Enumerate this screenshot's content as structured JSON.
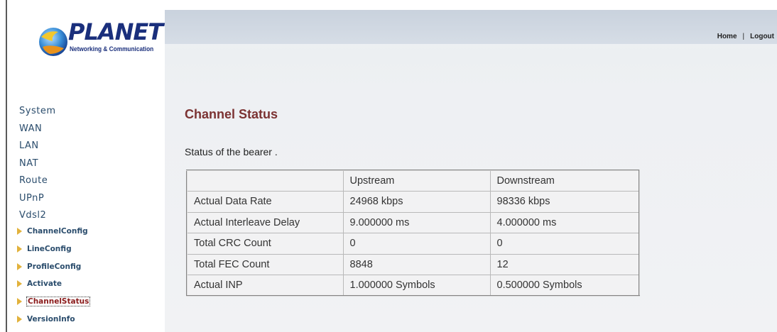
{
  "brand": {
    "name": "PLANET",
    "tagline": "Networking & Communication"
  },
  "header": {
    "home": "Home",
    "separator": "|",
    "logout": "Logout"
  },
  "nav": {
    "items": [
      "System",
      "WAN",
      "LAN",
      "NAT",
      "Route",
      "UPnP",
      "Vdsl2"
    ],
    "sub_items": [
      "ChannelConfig",
      "LineConfig",
      "ProfileConfig",
      "Activate",
      "ChannelStatus",
      "VersionInfo"
    ],
    "active_sub_item": "ChannelStatus"
  },
  "main": {
    "title": "Channel Status",
    "description": "Status of the bearer ."
  },
  "table": {
    "header": [
      "",
      "Upstream",
      "Downstream"
    ],
    "rows": [
      [
        "Actual Data Rate",
        "24968 kbps",
        "98336 kbps"
      ],
      [
        "Actual Interleave Delay",
        "9.000000 ms",
        "4.000000 ms"
      ],
      [
        "Total CRC Count",
        "0",
        "0"
      ],
      [
        "Total FEC Count",
        "8848",
        "12"
      ],
      [
        "Actual INP",
        "1.000000 Symbols",
        "0.500000 Symbols"
      ]
    ]
  },
  "colors": {
    "title": "#7b3232",
    "nav_text": "#2a4c6c",
    "active_sub": "#8a1a1a",
    "arrow": "#e2b23c",
    "top_bar": "#ccd4de"
  }
}
